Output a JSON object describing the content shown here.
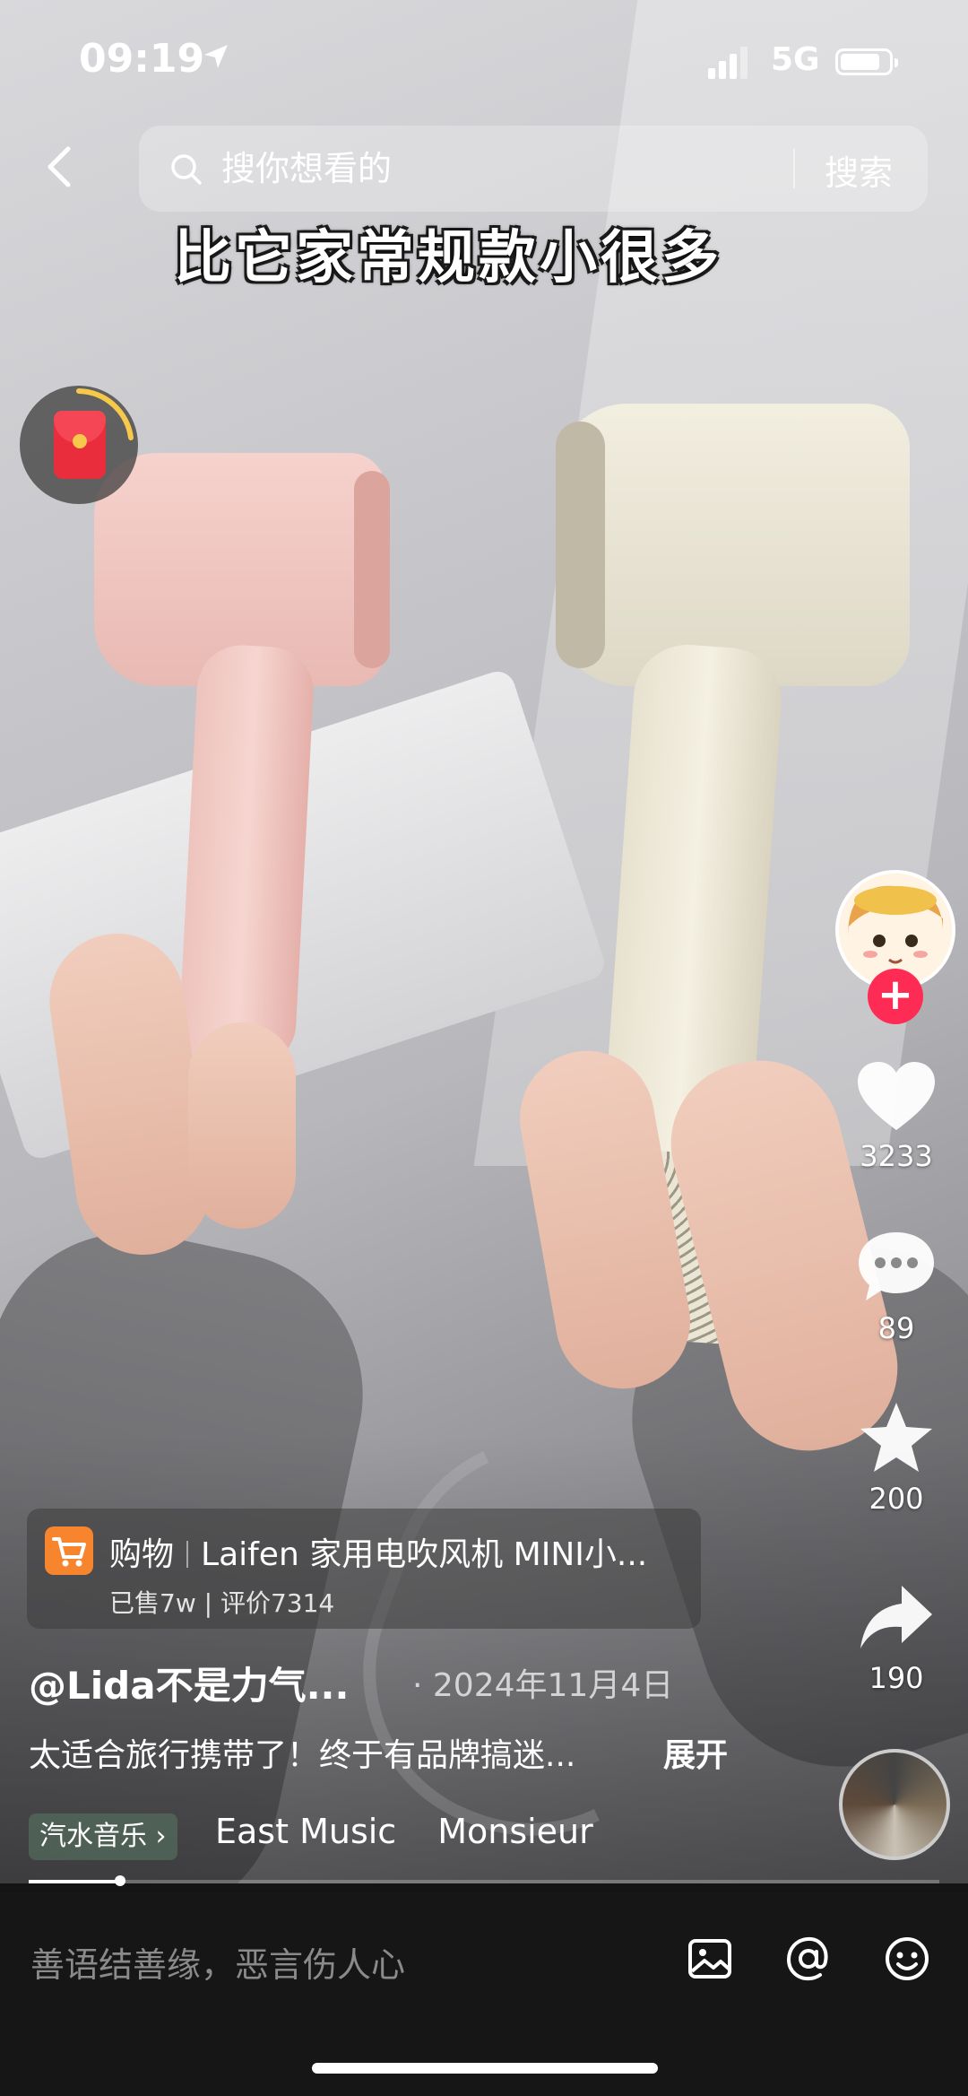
{
  "status": {
    "time": "09:19",
    "network": "5G",
    "battery_level": 0.85
  },
  "search": {
    "placeholder": "搜你想看的",
    "button": "搜索"
  },
  "caption": "比它家常规款小很多",
  "rail": {
    "likes": "3233",
    "comments": "89",
    "favorites": "200",
    "shares": "190"
  },
  "shop": {
    "category": "购物",
    "title": "Laifen 家用电吹风机 MINI小...",
    "sub": "已售7w | 评价7314"
  },
  "post": {
    "author": "@Lida不是力气...",
    "date": "· 2024年11月4日",
    "desc": "太适合旅行携带了！终于有品牌搞迷...",
    "expand": "展开"
  },
  "music": {
    "tag": "汽水音乐 ›",
    "name": "East Music",
    "name2": "Monsieur"
  },
  "progress": 0.1,
  "comment": {
    "placeholder": "善语结善缘，恶言伤人心"
  },
  "colors": {
    "like_red": "#fe2c55",
    "shop_orange": "#f7852d",
    "packet_red": "#e92d3c"
  }
}
